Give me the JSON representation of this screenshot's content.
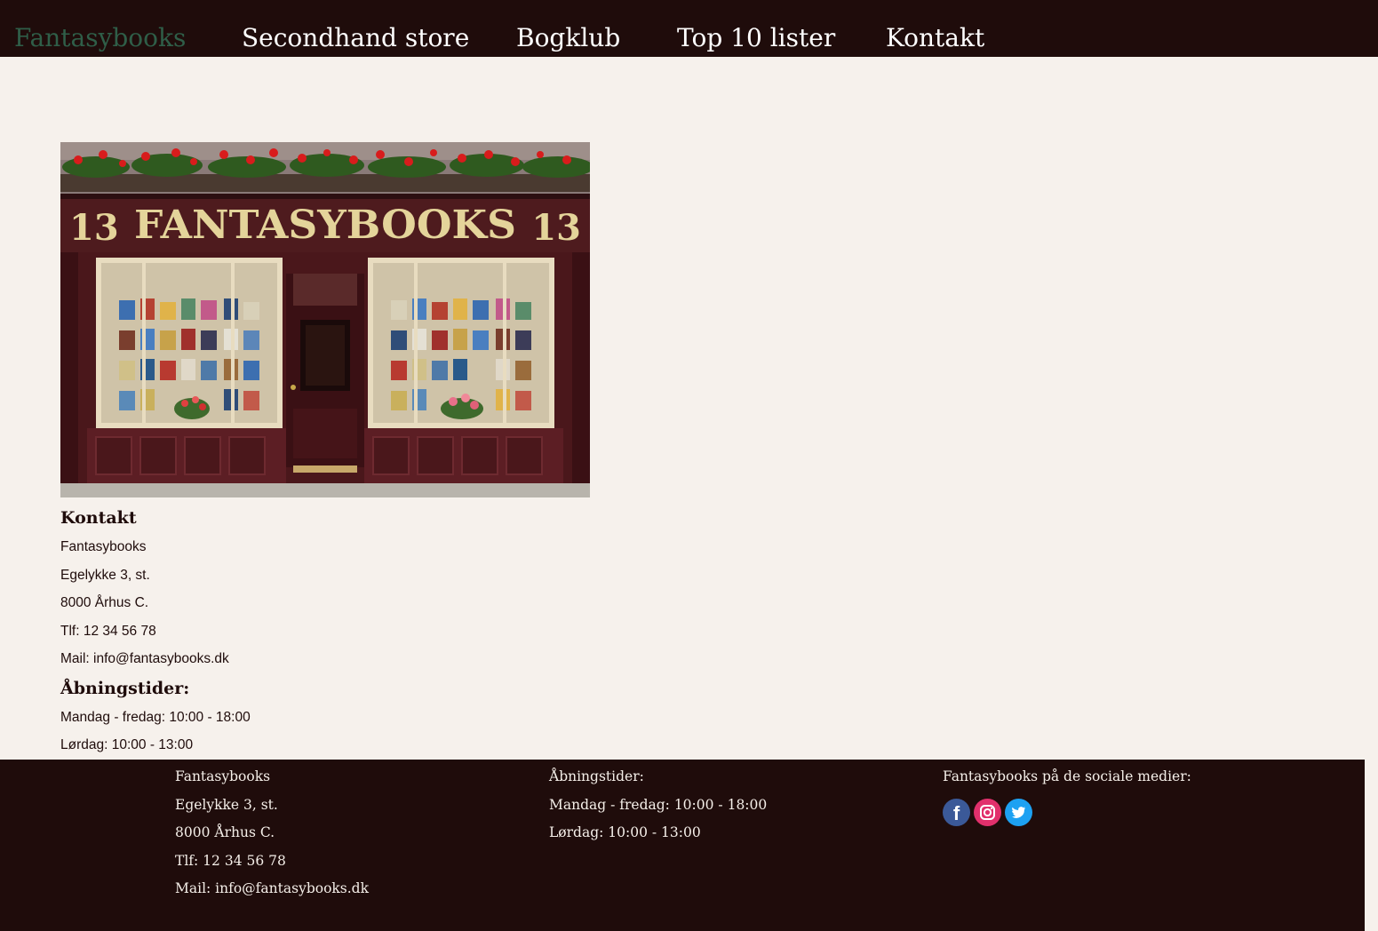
{
  "nav": {
    "brand": "Fantasybooks",
    "items": [
      "Secondhand store",
      "Bogklub",
      "Top 10 lister",
      "Kontakt"
    ]
  },
  "storefront": {
    "sign_text": "FANTASYBOOKS",
    "number_left": "13",
    "number_right": "13"
  },
  "contact": {
    "heading": "Kontakt",
    "lines": [
      "Fantasybooks",
      "Egelykke 3, st.",
      "8000 Århus C.",
      "Tlf: 12 34 56 78",
      "Mail: info@fantasybooks.dk"
    ],
    "hours_heading": "Åbningstider:",
    "hours": [
      "Mandag - fredag: 10:00 - 18:00",
      "Lørdag: 10:00 - 13:00"
    ]
  },
  "footer": {
    "address_lines": [
      "Fantasybooks",
      "Egelykke 3, st.",
      "8000 Århus C.",
      "Tlf: 12 34 56 78",
      "Mail: info@fantasybooks.dk"
    ],
    "hours_title": "Åbningstider:",
    "hours_lines": [
      "Mandag - fredag: 10:00 - 18:00",
      "Lørdag: 10:00 - 13:00"
    ],
    "social_title": "Fantasybooks på de sociale medier:",
    "social_icons": [
      "facebook-icon",
      "instagram-icon",
      "twitter-icon"
    ]
  },
  "colors": {
    "nav_bg": "#1f0c0b",
    "brand": "#2f5e48",
    "page_bg": "#f6f1ec",
    "store_wood": "#4e1b1e",
    "sign_gold": "#e4d49a"
  }
}
